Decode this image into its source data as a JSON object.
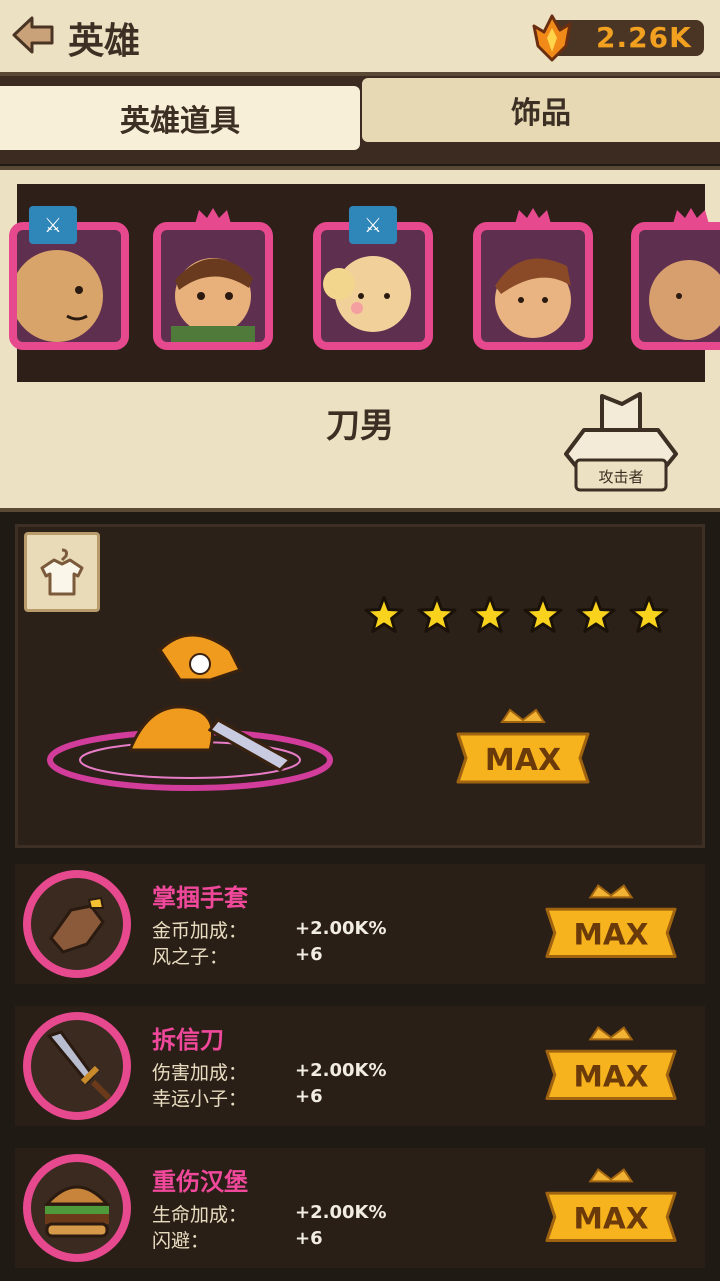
{
  "header": {
    "title": "英雄",
    "currency_value": "2.26K"
  },
  "tabs": [
    {
      "label": "英雄道具"
    },
    {
      "label": "饰品"
    }
  ],
  "hero": {
    "name": "刀男",
    "role_label": "攻击者",
    "star_count": 6,
    "level_status": "MAX"
  },
  "items": [
    {
      "name": "掌掴手套",
      "stats": [
        {
          "label": "金币加成：",
          "value": "+2.00K%"
        },
        {
          "label": "风之子：",
          "value": "+6"
        }
      ],
      "status": "MAX",
      "icon": "glove-icon"
    },
    {
      "name": "拆信刀",
      "stats": [
        {
          "label": "伤害加成：",
          "value": "+2.00K%"
        },
        {
          "label": "幸运小子：",
          "value": "+6"
        }
      ],
      "status": "MAX",
      "icon": "sword-icon"
    },
    {
      "name": "重伤汉堡",
      "stats": [
        {
          "label": "生命加成：",
          "value": "+2.00K%"
        },
        {
          "label": "闪避：",
          "value": "+6"
        }
      ],
      "status": "MAX",
      "icon": "burger-icon"
    }
  ],
  "colors": {
    "accent_pink": "#e6498e",
    "gold": "#f2a020",
    "panel": "#ede1c3",
    "dark": "#2a1f17"
  }
}
